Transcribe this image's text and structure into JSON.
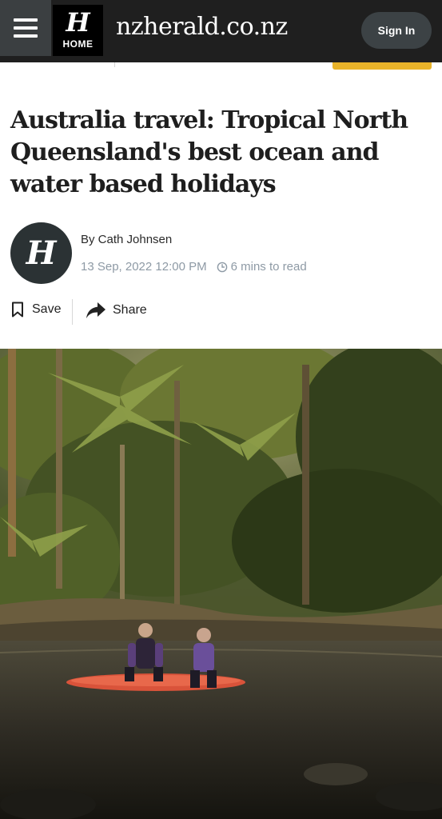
{
  "header": {
    "menu_icon": "hamburger-menu-icon",
    "logo_glyph": "H",
    "logo_label": "HOME",
    "site_name": "nzherald.co.nz",
    "sign_in_label": "Sign In"
  },
  "article": {
    "headline": "Australia travel: Tropical North Queensland's best ocean and water based holidays",
    "author_avatar_glyph": "H",
    "author": "By Cath Johnsen",
    "date": "13 Sep, 2022 12:00 PM",
    "read_time": "6 mins to read",
    "clock_icon": "clock-icon",
    "save_label": "Save",
    "save_icon": "bookmark-icon",
    "share_label": "Share",
    "share_icon": "share-arrow-icon"
  },
  "colors": {
    "header_bg": "#1f1f1f",
    "signin_bg": "#3c4245",
    "meta_text": "#8e9aa5",
    "accent_tag": "#e8b32a"
  }
}
